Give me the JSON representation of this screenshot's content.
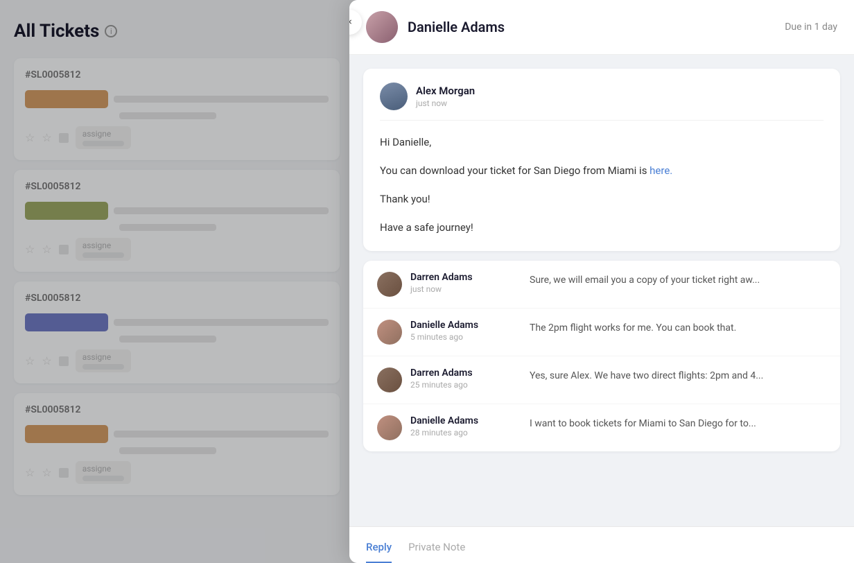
{
  "page": {
    "title": "All Tickets",
    "title_info": "i"
  },
  "tickets": [
    {
      "id": "#SL0005812",
      "bar_color": "#c87a2a"
    },
    {
      "id": "#SL0005812",
      "bar_color": "#7a8a2a"
    },
    {
      "id": "#SL0005812",
      "bar_color": "#3a4ab0"
    },
    {
      "id": "#SL0005812",
      "bar_color": "#c87a2a"
    }
  ],
  "modal": {
    "close_label": "×",
    "header": {
      "name": "Danielle Adams",
      "due": "Due in 1 day"
    },
    "main_message": {
      "sender": "Alex Morgan",
      "timestamp": "just now",
      "greeting": "Hi Danielle,",
      "body_line1": "You can download your ticket for San Diego from Miami is ",
      "link_text": "here.",
      "body_line2": "Thank you!",
      "body_line3": "Have a safe journey!"
    },
    "thread": [
      {
        "sender": "Darren Adams",
        "timestamp": "just now",
        "preview": "Sure, we will email you a copy of your ticket right aw...",
        "avatar_type": "darren"
      },
      {
        "sender": "Danielle Adams",
        "timestamp": "5 minutes ago",
        "preview": "The 2pm flight works for me. You can book that.",
        "avatar_type": "danielle"
      },
      {
        "sender": "Darren Adams",
        "timestamp": "25 minutes ago",
        "preview": "Yes, sure Alex. We have two direct flights: 2pm and 4...",
        "avatar_type": "darren"
      },
      {
        "sender": "Danielle Adams",
        "timestamp": "28 minutes ago",
        "preview": "I want to book tickets for Miami to San Diego for to...",
        "avatar_type": "danielle"
      }
    ],
    "footer": {
      "tabs": [
        {
          "label": "Reply",
          "active": true
        },
        {
          "label": "Private Note",
          "active": false
        }
      ]
    }
  }
}
